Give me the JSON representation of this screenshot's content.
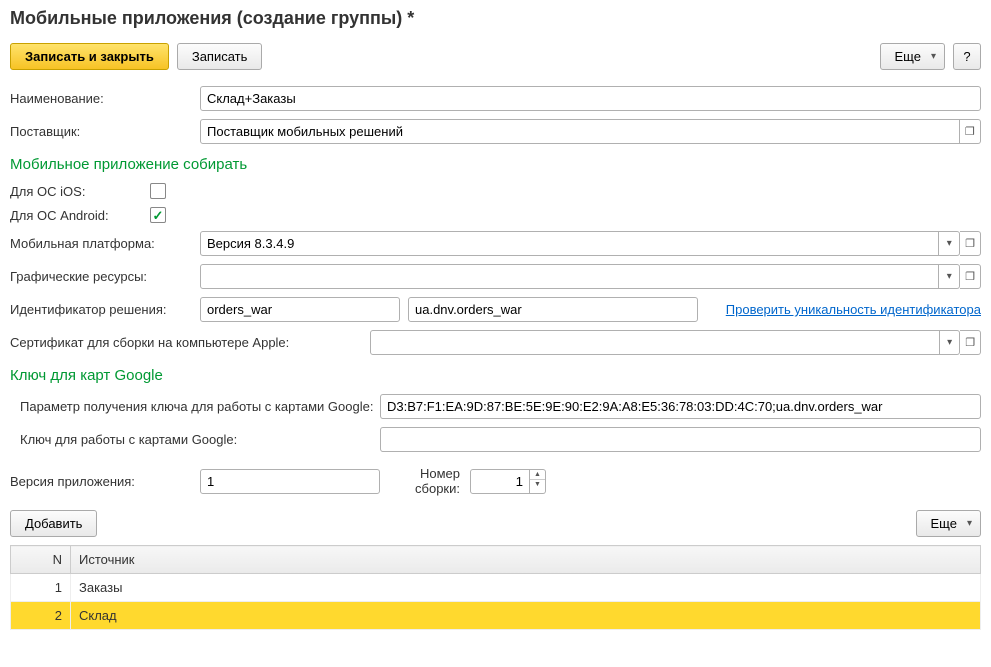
{
  "title": "Мобильные приложения (создание группы) *",
  "toolbar": {
    "save_close": "Записать и закрыть",
    "save": "Записать",
    "more": "Еще",
    "help": "?"
  },
  "labels": {
    "name": "Наименование:",
    "supplier": "Поставщик:",
    "ios": "Для ОС iOS:",
    "android": "Для ОС Android:",
    "platform": "Мобильная платформа:",
    "graphics": "Графические ресурсы:",
    "solution_id": "Идентификатор решения:",
    "apple_cert": "Сертификат для сборки на компьютере Apple:",
    "google_param": "Параметр получения ключа для работы с картами Google:",
    "google_key": "Ключ для работы с картами Google:",
    "app_version": "Версия приложения:",
    "build_number": "Номер сборки:",
    "add": "Добавить",
    "check_unique": "Проверить уникальность идентификатора"
  },
  "sections": {
    "build": "Мобильное приложение собирать",
    "google": "Ключ для карт Google"
  },
  "values": {
    "name": "Склад+Заказы",
    "supplier": "Поставщик мобильных решений",
    "platform": "Версия 8.3.4.9",
    "graphics": "",
    "solution_id1": "orders_war",
    "solution_id2": "ua.dnv.orders_war",
    "apple_cert": "",
    "google_param": "D3:B7:F1:EA:9D:87:BE:5E:9E:90:E2:9A:A8:E5:36:78:03:DD:4C:70;ua.dnv.orders_war",
    "google_key": "",
    "app_version": "1",
    "build_number": "1"
  },
  "table": {
    "headers": {
      "n": "N",
      "source": "Источник"
    },
    "rows": [
      {
        "n": "1",
        "source": "Заказы"
      },
      {
        "n": "2",
        "source": "Склад"
      }
    ]
  }
}
